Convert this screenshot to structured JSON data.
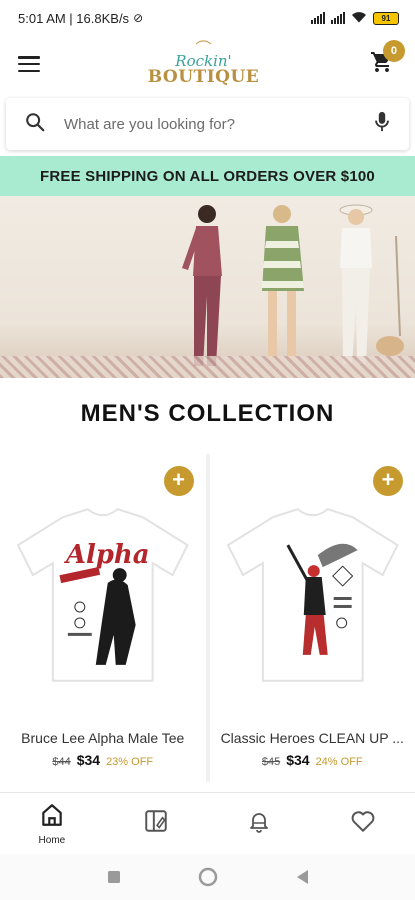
{
  "status_bar": {
    "time_speed": "5:01 AM | 16.8KB/s",
    "battery": "91"
  },
  "header": {
    "logo_top": "Rockin'",
    "logo_bottom": "BOUTIQUE",
    "cart_count": "0"
  },
  "search": {
    "placeholder": "What are you looking for?"
  },
  "banner": {
    "text": "FREE SHIPPING ON ALL ORDERS OVER $100"
  },
  "section": {
    "title": "MEN'S COLLECTION"
  },
  "products": [
    {
      "name": "Bruce Lee Alpha Male Tee",
      "old_price": "$44",
      "price": "$34",
      "discount": "23% OFF",
      "print_text": "Alpha"
    },
    {
      "name": "Classic Heroes CLEAN UP ...",
      "old_price": "$45",
      "price": "$34",
      "discount": "24% OFF",
      "print_text": ""
    }
  ],
  "bottom_nav": {
    "home_label": "Home"
  },
  "colors": {
    "accent": "#c69a2e",
    "banner_bg": "#a9ebd1",
    "logo_teal": "#3aa39a"
  }
}
